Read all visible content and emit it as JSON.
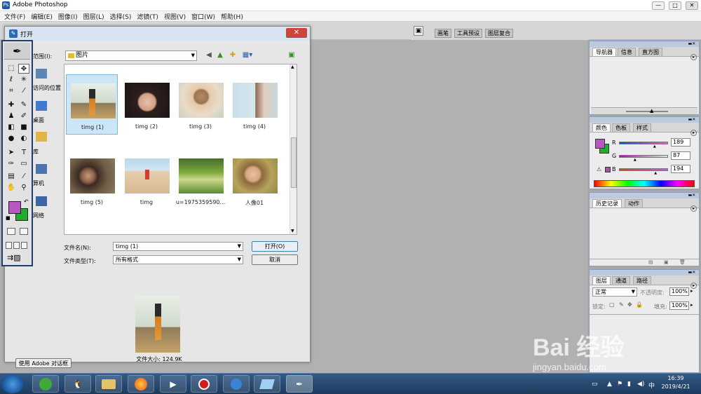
{
  "window": {
    "title": "Adobe Photoshop",
    "ctrl_min": "—",
    "ctrl_max": "□",
    "ctrl_close": "✕"
  },
  "menu": [
    "文件(F)",
    "编辑(E)",
    "图像(I)",
    "图层(L)",
    "选择(S)",
    "滤镜(T)",
    "视图(V)",
    "窗口(W)",
    "帮助(H)"
  ],
  "dock_tabs": [
    "画笔",
    "工具预设",
    "图层复合"
  ],
  "dialog": {
    "title": "打开",
    "close": "✕",
    "look_in_label": "范围(I):",
    "look_in_value": "图片",
    "places": [
      "访问的位置",
      "桌面",
      "库",
      "算机",
      "网络"
    ],
    "files": [
      {
        "name": "timg (1)",
        "selected": true
      },
      {
        "name": "timg (2)",
        "selected": false
      },
      {
        "name": "timg (3)",
        "selected": false
      },
      {
        "name": "timg (4)",
        "selected": false
      },
      {
        "name": "timg (5)",
        "selected": false
      },
      {
        "name": "timg",
        "selected": false
      },
      {
        "name": "u=1975359590...",
        "selected": false
      },
      {
        "name": "人像01",
        "selected": false
      }
    ],
    "filename_label": "文件名(N):",
    "filename_value": "timg (1)",
    "filetype_label": "文件类型(T):",
    "filetype_value": "所有格式",
    "open_button": "打开(O)",
    "cancel_button": "取消",
    "file_size": "文件大小: 124.9K",
    "adobe_dialog_button": "使用 Adobe 对话框"
  },
  "panels": {
    "navigator": {
      "tabs": [
        "导航器",
        "信息",
        "直方图"
      ]
    },
    "color": {
      "tabs": [
        "颜色",
        "色板",
        "样式"
      ],
      "r_label": "R",
      "g_label": "G",
      "b_label": "B",
      "r": 189,
      "g": 87,
      "b": 194,
      "warning": "⚠"
    },
    "history": {
      "tabs": [
        "历史记录",
        "动作"
      ]
    },
    "layers": {
      "tabs": [
        "图层",
        "通道",
        "路径"
      ],
      "blend_mode": "正常",
      "opacity_label": "不透明度:",
      "opacity_value": "100%",
      "lock_label": "锁定:",
      "fill_label": "填充:",
      "fill_value": "100%"
    }
  },
  "colors": {
    "foreground": "#b957c2",
    "background": "#1fae2b"
  },
  "taskbar": {
    "time": "16:39",
    "date": "2019/4/21"
  },
  "watermark": {
    "logo": "Bai  经验",
    "url": "jingyan.baidu.com"
  }
}
